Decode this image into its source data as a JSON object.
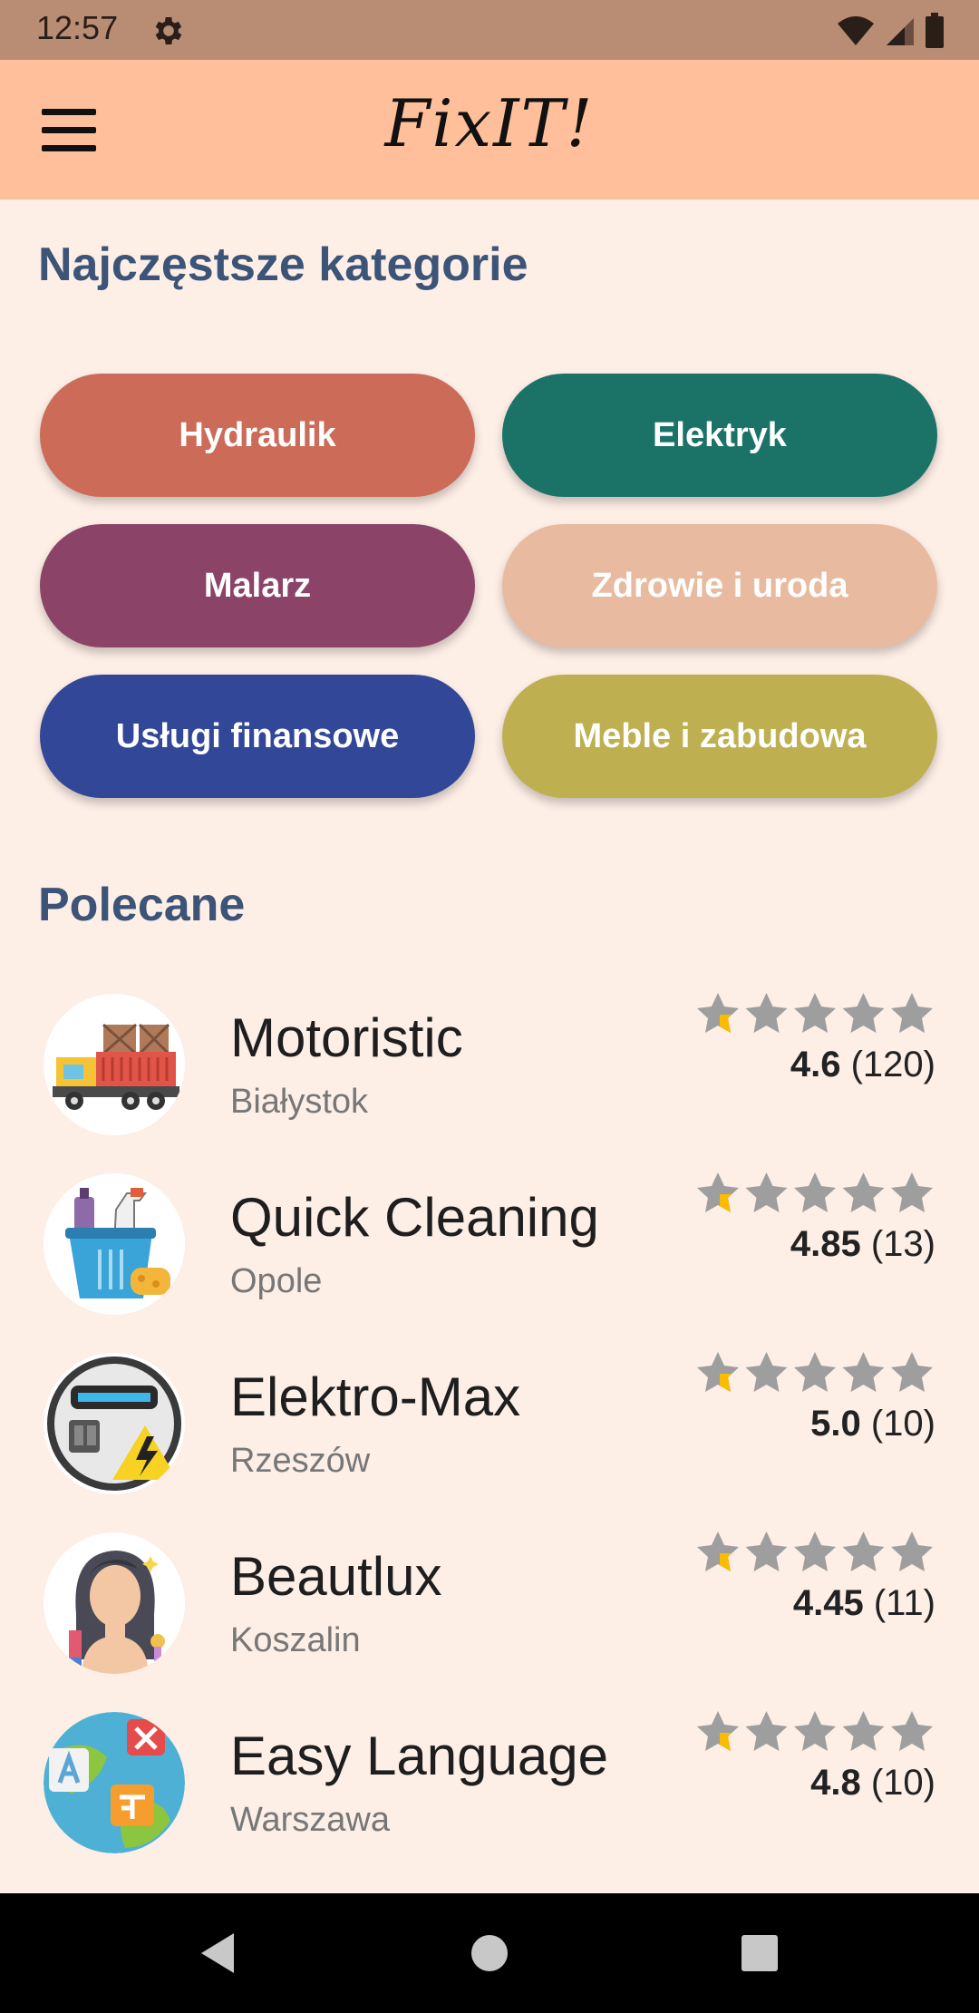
{
  "status_bar": {
    "time": "12:57"
  },
  "app_bar": {
    "title": "FixIT!"
  },
  "categories": {
    "title": "Najczęstsze kategorie",
    "items": [
      {
        "label": "Hydraulik",
        "color": "#cc6b58"
      },
      {
        "label": "Elektryk",
        "color": "#1b7368"
      },
      {
        "label": "Malarz",
        "color": "#8b4468"
      },
      {
        "label": "Zdrowie i uroda",
        "color": "#e8bba0"
      },
      {
        "label": "Usługi finansowe",
        "color": "#324797"
      },
      {
        "label": "Meble i zabudowa",
        "color": "#beb050"
      }
    ]
  },
  "recommended": {
    "title": "Polecane",
    "items": [
      {
        "name": "Motoristic",
        "city": "Białystok",
        "score": "4.6",
        "count": "(120)",
        "stars": 4.6,
        "icon": "truck-icon"
      },
      {
        "name": "Quick Cleaning",
        "city": "Opole",
        "score": "4.85",
        "count": "(13)",
        "stars": 4.85,
        "icon": "cleaning-bucket-icon"
      },
      {
        "name": "Elektro-Max",
        "city": "Rzeszów",
        "score": "5.0",
        "count": "(10)",
        "stars": 5.0,
        "icon": "electric-meter-icon"
      },
      {
        "name": "Beautlux",
        "city": "Koszalin",
        "score": "4.45",
        "count": "(11)",
        "stars": 4.45,
        "icon": "beauty-woman-icon"
      },
      {
        "name": "Easy Language",
        "city": "Warszawa",
        "score": "4.8",
        "count": "(10)",
        "stars": 4.8,
        "icon": "language-globe-icon"
      }
    ]
  },
  "colors": {
    "star": "#fbbb00",
    "star_empty": "#9e9e9e",
    "accent": "#3c5478"
  }
}
